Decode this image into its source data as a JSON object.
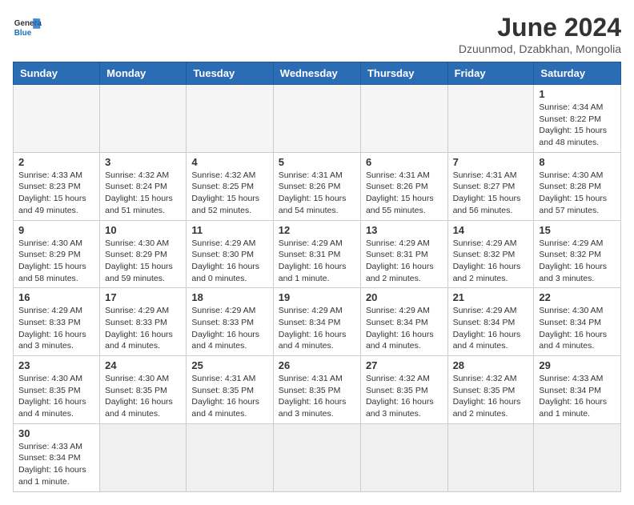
{
  "header": {
    "logo_general": "General",
    "logo_blue": "Blue",
    "month_title": "June 2024",
    "subtitle": "Dzuunmod, Dzabkhan, Mongolia"
  },
  "weekdays": [
    "Sunday",
    "Monday",
    "Tuesday",
    "Wednesday",
    "Thursday",
    "Friday",
    "Saturday"
  ],
  "weeks": [
    [
      {
        "day": "",
        "info": ""
      },
      {
        "day": "",
        "info": ""
      },
      {
        "day": "",
        "info": ""
      },
      {
        "day": "",
        "info": ""
      },
      {
        "day": "",
        "info": ""
      },
      {
        "day": "",
        "info": ""
      },
      {
        "day": "1",
        "info": "Sunrise: 4:34 AM\nSunset: 8:22 PM\nDaylight: 15 hours\nand 48 minutes."
      }
    ],
    [
      {
        "day": "2",
        "info": "Sunrise: 4:33 AM\nSunset: 8:23 PM\nDaylight: 15 hours\nand 49 minutes."
      },
      {
        "day": "3",
        "info": "Sunrise: 4:32 AM\nSunset: 8:24 PM\nDaylight: 15 hours\nand 51 minutes."
      },
      {
        "day": "4",
        "info": "Sunrise: 4:32 AM\nSunset: 8:25 PM\nDaylight: 15 hours\nand 52 minutes."
      },
      {
        "day": "5",
        "info": "Sunrise: 4:31 AM\nSunset: 8:26 PM\nDaylight: 15 hours\nand 54 minutes."
      },
      {
        "day": "6",
        "info": "Sunrise: 4:31 AM\nSunset: 8:26 PM\nDaylight: 15 hours\nand 55 minutes."
      },
      {
        "day": "7",
        "info": "Sunrise: 4:31 AM\nSunset: 8:27 PM\nDaylight: 15 hours\nand 56 minutes."
      },
      {
        "day": "8",
        "info": "Sunrise: 4:30 AM\nSunset: 8:28 PM\nDaylight: 15 hours\nand 57 minutes."
      }
    ],
    [
      {
        "day": "9",
        "info": "Sunrise: 4:30 AM\nSunset: 8:29 PM\nDaylight: 15 hours\nand 58 minutes."
      },
      {
        "day": "10",
        "info": "Sunrise: 4:30 AM\nSunset: 8:29 PM\nDaylight: 15 hours\nand 59 minutes."
      },
      {
        "day": "11",
        "info": "Sunrise: 4:29 AM\nSunset: 8:30 PM\nDaylight: 16 hours\nand 0 minutes."
      },
      {
        "day": "12",
        "info": "Sunrise: 4:29 AM\nSunset: 8:31 PM\nDaylight: 16 hours\nand 1 minute."
      },
      {
        "day": "13",
        "info": "Sunrise: 4:29 AM\nSunset: 8:31 PM\nDaylight: 16 hours\nand 2 minutes."
      },
      {
        "day": "14",
        "info": "Sunrise: 4:29 AM\nSunset: 8:32 PM\nDaylight: 16 hours\nand 2 minutes."
      },
      {
        "day": "15",
        "info": "Sunrise: 4:29 AM\nSunset: 8:32 PM\nDaylight: 16 hours\nand 3 minutes."
      }
    ],
    [
      {
        "day": "16",
        "info": "Sunrise: 4:29 AM\nSunset: 8:33 PM\nDaylight: 16 hours\nand 3 minutes."
      },
      {
        "day": "17",
        "info": "Sunrise: 4:29 AM\nSunset: 8:33 PM\nDaylight: 16 hours\nand 4 minutes."
      },
      {
        "day": "18",
        "info": "Sunrise: 4:29 AM\nSunset: 8:33 PM\nDaylight: 16 hours\nand 4 minutes."
      },
      {
        "day": "19",
        "info": "Sunrise: 4:29 AM\nSunset: 8:34 PM\nDaylight: 16 hours\nand 4 minutes."
      },
      {
        "day": "20",
        "info": "Sunrise: 4:29 AM\nSunset: 8:34 PM\nDaylight: 16 hours\nand 4 minutes."
      },
      {
        "day": "21",
        "info": "Sunrise: 4:29 AM\nSunset: 8:34 PM\nDaylight: 16 hours\nand 4 minutes."
      },
      {
        "day": "22",
        "info": "Sunrise: 4:30 AM\nSunset: 8:34 PM\nDaylight: 16 hours\nand 4 minutes."
      }
    ],
    [
      {
        "day": "23",
        "info": "Sunrise: 4:30 AM\nSunset: 8:35 PM\nDaylight: 16 hours\nand 4 minutes."
      },
      {
        "day": "24",
        "info": "Sunrise: 4:30 AM\nSunset: 8:35 PM\nDaylight: 16 hours\nand 4 minutes."
      },
      {
        "day": "25",
        "info": "Sunrise: 4:31 AM\nSunset: 8:35 PM\nDaylight: 16 hours\nand 4 minutes."
      },
      {
        "day": "26",
        "info": "Sunrise: 4:31 AM\nSunset: 8:35 PM\nDaylight: 16 hours\nand 3 minutes."
      },
      {
        "day": "27",
        "info": "Sunrise: 4:32 AM\nSunset: 8:35 PM\nDaylight: 16 hours\nand 3 minutes."
      },
      {
        "day": "28",
        "info": "Sunrise: 4:32 AM\nSunset: 8:35 PM\nDaylight: 16 hours\nand 2 minutes."
      },
      {
        "day": "29",
        "info": "Sunrise: 4:33 AM\nSunset: 8:34 PM\nDaylight: 16 hours\nand 1 minute."
      }
    ],
    [
      {
        "day": "30",
        "info": "Sunrise: 4:33 AM\nSunset: 8:34 PM\nDaylight: 16 hours\nand 1 minute."
      },
      {
        "day": "",
        "info": ""
      },
      {
        "day": "",
        "info": ""
      },
      {
        "day": "",
        "info": ""
      },
      {
        "day": "",
        "info": ""
      },
      {
        "day": "",
        "info": ""
      },
      {
        "day": "",
        "info": ""
      }
    ]
  ]
}
